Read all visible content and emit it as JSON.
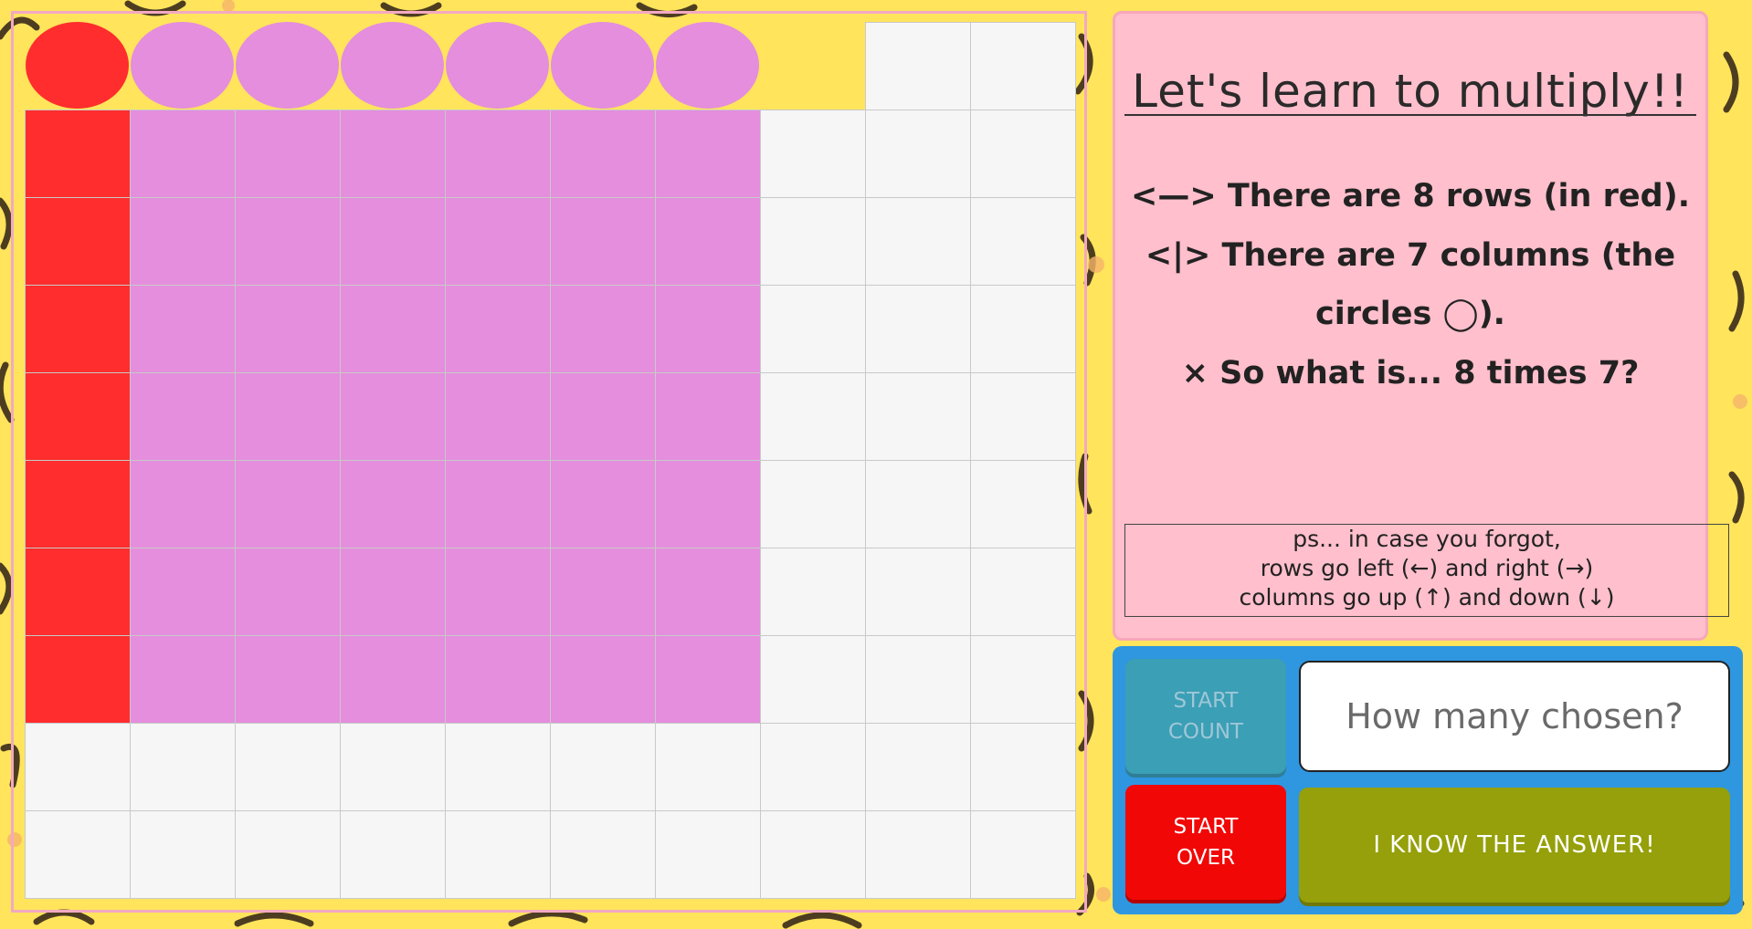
{
  "colors": {
    "background": "#ffe45c",
    "row_red": "#ff2d2d",
    "column_purple": "#e48edd",
    "empty_cell": "#f6f6f6",
    "panel_pink": "#ffbfcc",
    "control_blue": "#2f96e0"
  },
  "grid": {
    "total_rows": 10,
    "total_columns": 10,
    "chosen_rows": 8,
    "chosen_columns": 7
  },
  "info": {
    "title": "Let's learn to multiply!!",
    "line1": "<—> There are 8 rows (in red).",
    "line2": "<|> There are 7 columns (the",
    "line3": "circles ◯).",
    "line4": "× So what is... 8 times 7?",
    "ps_line1": "ps... in case you forgot,",
    "ps_line2": "rows go left (←) and right (→)",
    "ps_line3": "columns go up (↑) and down (↓)"
  },
  "controls": {
    "start_count_line1": "START",
    "start_count_line2": "COUNT",
    "answer_placeholder": "How many chosen?",
    "start_over_line1": "START",
    "start_over_line2": "OVER",
    "i_know_label": "I KNOW THE ANSWER!"
  }
}
